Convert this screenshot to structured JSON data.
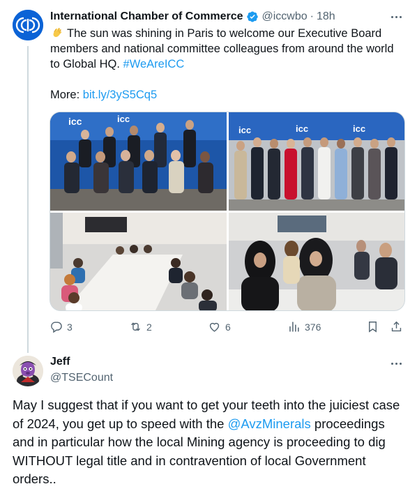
{
  "tweet": {
    "author_name": "International Chamber of Commerce",
    "handle": "@iccwbo",
    "separator": "·",
    "time": "18h",
    "text_part1": "The sun was shining in Paris to welcome our Executive Board members and national committee colleagues from around the world to Global HQ. ",
    "hashtag": "#WeAreICC",
    "more_label": "More: ",
    "more_link": "bit.ly/3yS5Cq5",
    "photo_signs": [
      "icc",
      "icc",
      "icc",
      "icc",
      "icc"
    ],
    "actions": {
      "replies": "3",
      "reposts": "2",
      "likes": "6",
      "views": "376"
    },
    "brand_color": "#1d9bf0"
  },
  "reply": {
    "author_name": "Jeff",
    "handle": "@TSECount",
    "text_part1": "May I suggest that if you want to get your teeth into the juiciest case of 2024, you get up to speed with the ",
    "mention": "@AvzMinerals",
    "text_part2": " proceedings and in particular how the local Mining agency is proceeding to dig WITHOUT legal title and in contravention of local Government orders.."
  }
}
